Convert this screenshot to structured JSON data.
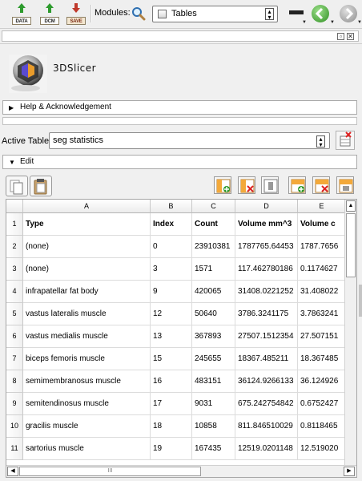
{
  "toolbar": {
    "data_label": "DATA",
    "dcm_label": "DCM",
    "save_label": "SAVE",
    "modules_label": "Modules:",
    "module_selected": "Tables"
  },
  "logo": {
    "text": "3DSlicer"
  },
  "sections": {
    "help": "Help & Acknowledgement",
    "edit": "Edit"
  },
  "active_table": {
    "label": "Active Table:",
    "value": "seg statistics"
  },
  "table": {
    "column_letters": [
      "A",
      "B",
      "C",
      "D",
      "E"
    ],
    "row_numbers": [
      "1",
      "2",
      "3",
      "4",
      "5",
      "6",
      "7",
      "8",
      "9",
      "10",
      "11"
    ],
    "header": [
      "Type",
      "Index",
      "Count",
      "Volume mm^3",
      "Volume c"
    ],
    "rows": [
      [
        "(none)",
        "0",
        "23910381",
        "1787765.64453",
        "1787.7656"
      ],
      [
        "(none)",
        "3",
        "1571",
        "117.462780186",
        "0.1174627"
      ],
      [
        "infrapatellar fat body",
        "9",
        "420065",
        "31408.0221252",
        "31.408022"
      ],
      [
        "vastus lateralis muscle",
        "12",
        "50640",
        "3786.3241175",
        "3.7863241"
      ],
      [
        "vastus medialis muscle",
        "13",
        "367893",
        "27507.1512354",
        "27.507151"
      ],
      [
        "biceps femoris muscle",
        "15",
        "245655",
        "18367.485211",
        "18.367485"
      ],
      [
        "semimembranosus muscle",
        "16",
        "483151",
        "36124.9266133",
        "36.124926"
      ],
      [
        "semitendinosus muscle",
        "17",
        "9031",
        "675.242754842",
        "0.6752427"
      ],
      [
        "gracilis muscle",
        "18",
        "10858",
        "811.846510029",
        "0.8118465"
      ],
      [
        "sartorius muscle",
        "19",
        "167435",
        "12519.0201148",
        "12.519020"
      ]
    ],
    "scroll_grip": "III"
  }
}
